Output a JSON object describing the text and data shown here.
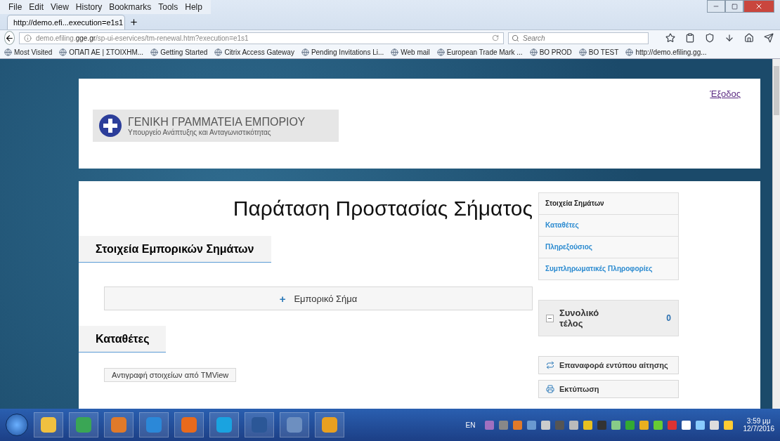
{
  "browser": {
    "menu": [
      "File",
      "Edit",
      "View",
      "History",
      "Bookmarks",
      "Tools",
      "Help"
    ],
    "tab": {
      "title": "http://demo.efi...execution=e1s1",
      "selected": true
    },
    "url": {
      "host": "demo.efiling.",
      "domain": "gge.gr",
      "path": "/sp-ui-eservices/tm-renewal.htm?execution=e1s1"
    },
    "search": {
      "placeholder": "Search"
    },
    "bookmarks": [
      "Most Visited",
      "ΟΠΑΠ ΑΕ | ΣΤΟΙΧΗΜ...",
      "Getting Started",
      "Citrix Access Gateway",
      "Pending Invitations  Li...",
      "Web mail",
      "European Trade Mark ...",
      "BO PROD",
      "BO TEST",
      "http://demo.efiling.gg..."
    ]
  },
  "header": {
    "logo_title": "ΓΕΝΙΚΗ ΓΡΑΜΜΑΤΕΙΑ ΕΜΠΟΡΙΟΥ",
    "logo_subtitle": "Υπουργείο Ανάπτυξης και Ανταγωνιστικότητας",
    "logout": "Έξοδος"
  },
  "page_title": "Παράταση Προστασίας Σήματος",
  "sections": [
    {
      "kind": "add",
      "heading": "Στοιχεία Εμπορικών Σημάτων",
      "button_icon": "+",
      "button_label": "Εμπορικό Σήμα"
    },
    {
      "kind": "copy",
      "heading": "Καταθέτες",
      "button_label": "Αντιγραφή στοιχείων από TMView"
    }
  ],
  "nav": [
    {
      "label": "Στοιχεία Σημάτων",
      "selected": true
    },
    {
      "label": "Καταθέτες",
      "selected": false
    },
    {
      "label": "Πληρεξούσιος",
      "selected": false
    },
    {
      "label": "Συμπληρωματικές Πληροφορίες",
      "selected": false
    }
  ],
  "total": {
    "label": "Συνολικό τέλος",
    "value": "0"
  },
  "actions": [
    {
      "kind": "reset",
      "label": "Επαναφορά εντύπου αίτησης"
    },
    {
      "kind": "print",
      "label": "Εκτύπωση"
    }
  ],
  "taskbar": {
    "language": "EN",
    "time": "3:59 μμ",
    "date": "12/7/2016"
  }
}
